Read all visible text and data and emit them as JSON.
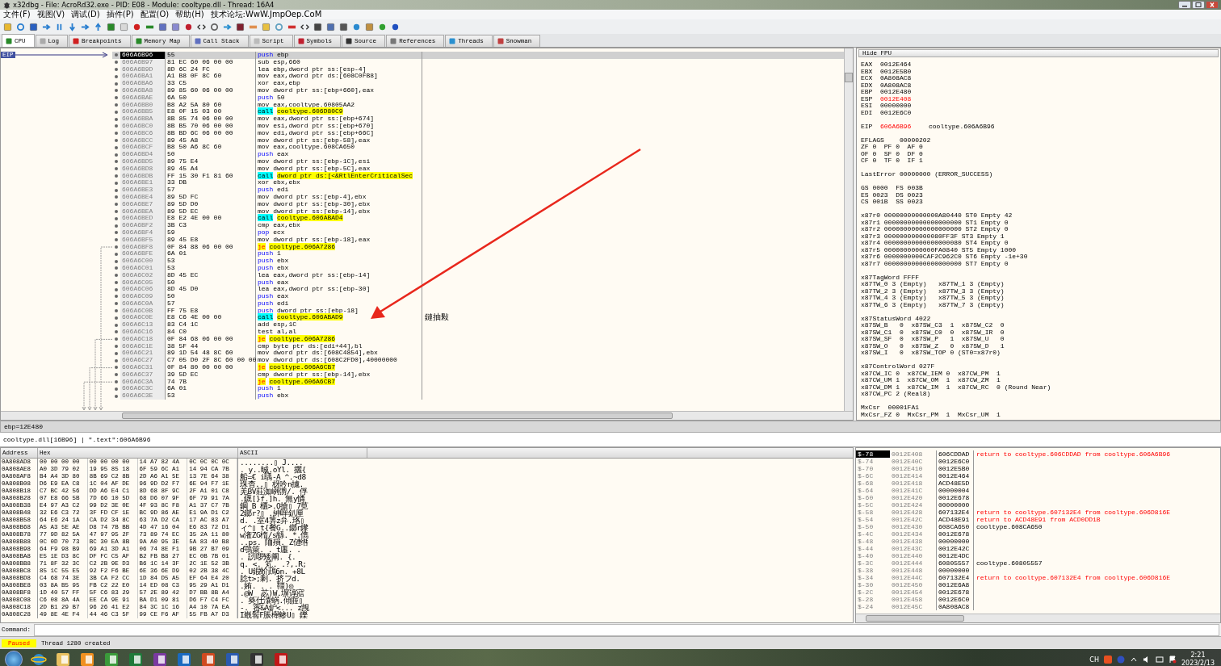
{
  "window": {
    "title": "x32dbg - File: AcroRd32.exe - PID: E08 - Module: cooltype.dll - Thread: 16A4"
  },
  "menu": [
    "文件(F)",
    "视图(V)",
    "调试(D)",
    "插件(P)",
    "配置(O)",
    "帮助(H)",
    "技术论坛:WwW.JmpOep.CoM"
  ],
  "tabs": [
    {
      "label": "CPU",
      "selected": true
    },
    {
      "label": "Log",
      "selected": false
    },
    {
      "label": "Breakpoints",
      "selected": false
    },
    {
      "label": "Memory Map",
      "selected": false
    },
    {
      "label": "Call Stack",
      "selected": false
    },
    {
      "label": "Script",
      "selected": false
    },
    {
      "label": "Symbols",
      "selected": false
    },
    {
      "label": "Source",
      "selected": false
    },
    {
      "label": "References",
      "selected": false
    },
    {
      "label": "Threads",
      "selected": false
    },
    {
      "label": "Snowman",
      "selected": false
    }
  ],
  "disassembly": {
    "eip_label": "EIP",
    "rows": [
      {
        "address": "606A6B96",
        "bytes": "55",
        "mnemonic": "push",
        "operands": "ebp",
        "kind": "push",
        "selected": true
      },
      {
        "address": "606A6B97",
        "bytes": "81 EC 60 06 00 00",
        "mnemonic": "sub",
        "operands": "esp,660",
        "kind": "plain",
        "selected": false
      },
      {
        "address": "606A6B9D",
        "bytes": "8D 6C 24 FC",
        "mnemonic": "lea",
        "operands": "ebp,dword ptr ss:[esp-4]",
        "kind": "plain",
        "selected": false
      },
      {
        "address": "606A6BA1",
        "bytes": "A1 B8 0F 8C 60",
        "mnemonic": "mov",
        "operands": "eax,dword ptr ds:[608C0FB8]",
        "kind": "plain",
        "selected": false
      },
      {
        "address": "606A6BA6",
        "bytes": "33 C5",
        "mnemonic": "xor",
        "operands": "eax,ebp",
        "kind": "plain",
        "selected": false
      },
      {
        "address": "606A6BA8",
        "bytes": "89 85 60 06 00 00",
        "mnemonic": "mov",
        "operands": "dword ptr ss:[ebp+660],eax",
        "kind": "plain",
        "selected": false
      },
      {
        "address": "606A6BAE",
        "bytes": "6A 50",
        "mnemonic": "push",
        "operands": "50",
        "kind": "push",
        "selected": false
      },
      {
        "address": "606A6BB0",
        "bytes": "B8 A2 5A 80 60",
        "mnemonic": "mov",
        "operands": "eax,cooltype.60805AA2",
        "kind": "plain",
        "selected": false
      },
      {
        "address": "606A6BB5",
        "bytes": "E8 0F 15 03 00",
        "mnemonic": "call",
        "operands": "cooltype.606D80C9",
        "kind": "call",
        "selected": false
      },
      {
        "address": "606A6BBA",
        "bytes": "8B 85 74 06 00 00",
        "mnemonic": "mov",
        "operands": "eax,dword ptr ss:[ebp+674]",
        "kind": "plain",
        "selected": false
      },
      {
        "address": "606A6BC0",
        "bytes": "8B B5 70 06 00 00",
        "mnemonic": "mov",
        "operands": "esi,dword ptr ss:[ebp+670]",
        "kind": "plain",
        "selected": false
      },
      {
        "address": "606A6BC6",
        "bytes": "8B BD 6C 06 00 00",
        "mnemonic": "mov",
        "operands": "edi,dword ptr ss:[ebp+66C]",
        "kind": "plain",
        "selected": false
      },
      {
        "address": "606A6BCC",
        "bytes": "89 45 A8",
        "mnemonic": "mov",
        "operands": "dword ptr ss:[ebp-58],eax",
        "kind": "plain",
        "selected": false
      },
      {
        "address": "606A6BCF",
        "bytes": "B8 50 A6 8C 60",
        "mnemonic": "mov",
        "operands": "eax,cooltype.608CA650",
        "kind": "plain",
        "selected": false
      },
      {
        "address": "606A6BD4",
        "bytes": "50",
        "mnemonic": "push",
        "operands": "eax",
        "kind": "push",
        "selected": false
      },
      {
        "address": "606A6BD5",
        "bytes": "89 75 E4",
        "mnemonic": "mov",
        "operands": "dword ptr ss:[ebp-1C],esi",
        "kind": "plain",
        "selected": false
      },
      {
        "address": "606A6BD8",
        "bytes": "89 45 A4",
        "mnemonic": "mov",
        "operands": "dword ptr ss:[ebp-5C],eax",
        "kind": "plain",
        "selected": false
      },
      {
        "address": "606A6BDB",
        "bytes": "FF 15 30 F1 81 60",
        "mnemonic": "call",
        "operands": "dword ptr ds:[<&RtlEnterCriticalSec",
        "kind": "call",
        "selected": false
      },
      {
        "address": "606A6BE1",
        "bytes": "33 DB",
        "mnemonic": "xor",
        "operands": "ebx,ebx",
        "kind": "plain",
        "selected": false
      },
      {
        "address": "606A6BE3",
        "bytes": "57",
        "mnemonic": "push",
        "operands": "edi",
        "kind": "push",
        "selected": false
      },
      {
        "address": "606A6BE4",
        "bytes": "89 5D FC",
        "mnemonic": "mov",
        "operands": "dword ptr ss:[ebp-4],ebx",
        "kind": "plain",
        "selected": false
      },
      {
        "address": "606A6BE7",
        "bytes": "89 5D D0",
        "mnemonic": "mov",
        "operands": "dword ptr ss:[ebp-30],ebx",
        "kind": "plain",
        "selected": false
      },
      {
        "address": "606A6BEA",
        "bytes": "89 5D EC",
        "mnemonic": "mov",
        "operands": "dword ptr ss:[ebp-14],ebx",
        "kind": "plain",
        "selected": false
      },
      {
        "address": "606A6BED",
        "bytes": "E8 E2 4E 00 00",
        "mnemonic": "call",
        "operands": "cooltype.606ABAD4",
        "kind": "call",
        "selected": false
      },
      {
        "address": "606A6BF2",
        "bytes": "3B C3",
        "mnemonic": "cmp",
        "operands": "eax,ebx",
        "kind": "plain",
        "selected": false
      },
      {
        "address": "606A6BF4",
        "bytes": "59",
        "mnemonic": "pop",
        "operands": "ecx",
        "kind": "push",
        "selected": false
      },
      {
        "address": "606A6BF5",
        "bytes": "89 45 E8",
        "mnemonic": "mov",
        "operands": "dword ptr ss:[ebp-18],eax",
        "kind": "plain",
        "selected": false
      },
      {
        "address": "606A6BF8",
        "bytes": "0F 84 88 06 00 00",
        "mnemonic": "je",
        "operands": "cooltype.606A7286",
        "kind": "jump",
        "selected": false
      },
      {
        "address": "606A6BFE",
        "bytes": "6A 01",
        "mnemonic": "push",
        "operands": "1",
        "kind": "push",
        "selected": false
      },
      {
        "address": "606A6C00",
        "bytes": "53",
        "mnemonic": "push",
        "operands": "ebx",
        "kind": "push",
        "selected": false
      },
      {
        "address": "606A6C01",
        "bytes": "53",
        "mnemonic": "push",
        "operands": "ebx",
        "kind": "push",
        "selected": false
      },
      {
        "address": "606A6C02",
        "bytes": "8D 45 EC",
        "mnemonic": "lea",
        "operands": "eax,dword ptr ss:[ebp-14]",
        "kind": "plain",
        "selected": false
      },
      {
        "address": "606A6C05",
        "bytes": "50",
        "mnemonic": "push",
        "operands": "eax",
        "kind": "push",
        "selected": false
      },
      {
        "address": "606A6C06",
        "bytes": "8D 45 D0",
        "mnemonic": "lea",
        "operands": "eax,dword ptr ss:[ebp-30]",
        "kind": "plain",
        "selected": false
      },
      {
        "address": "606A6C09",
        "bytes": "50",
        "mnemonic": "push",
        "operands": "eax",
        "kind": "push",
        "selected": false
      },
      {
        "address": "606A6C0A",
        "bytes": "57",
        "mnemonic": "push",
        "operands": "edi",
        "kind": "push",
        "selected": false
      },
      {
        "address": "606A6C0B",
        "bytes": "FF 75 E8",
        "mnemonic": "push",
        "operands": "dword ptr ss:[ebp-18]",
        "kind": "push",
        "selected": false
      },
      {
        "address": "606A6C0E",
        "bytes": "E8 C6 4E 00 00",
        "mnemonic": "call",
        "operands": "cooltype.606ABAD9",
        "kind": "call",
        "selected": false,
        "comment": "鏈抽敤"
      },
      {
        "address": "606A6C13",
        "bytes": "83 C4 1C",
        "mnemonic": "add",
        "operands": "esp,1C",
        "kind": "plain",
        "selected": false
      },
      {
        "address": "606A6C16",
        "bytes": "84 C0",
        "mnemonic": "test",
        "operands": "al,al",
        "kind": "plain",
        "selected": false
      },
      {
        "address": "606A6C18",
        "bytes": "0F 84 68 06 00 00",
        "mnemonic": "je",
        "operands": "cooltype.606A7286",
        "kind": "jump",
        "selected": false
      },
      {
        "address": "606A6C1E",
        "bytes": "38 5F 44",
        "mnemonic": "cmp",
        "operands": "byte ptr ds:[edi+44],bl",
        "kind": "plain",
        "selected": false
      },
      {
        "address": "606A6C21",
        "bytes": "89 1D 54 48 8C 60",
        "mnemonic": "mov",
        "operands": "dword ptr ds:[608C4854],ebx",
        "kind": "plain",
        "selected": false
      },
      {
        "address": "606A6C27",
        "bytes": "C7 05 D0 2F 8C 60 00 00",
        "mnemonic": "mov",
        "operands": "dword ptr ds:[608C2FD0],40000000",
        "kind": "plain",
        "selected": false
      },
      {
        "address": "606A6C31",
        "bytes": "0F 84 80 00 00 00",
        "mnemonic": "je",
        "operands": "cooltype.606A6CB7",
        "kind": "jump",
        "selected": false
      },
      {
        "address": "606A6C37",
        "bytes": "39 5D EC",
        "mnemonic": "cmp",
        "operands": "dword ptr ss:[ebp-14],ebx",
        "kind": "plain",
        "selected": false
      },
      {
        "address": "606A6C3A",
        "bytes": "74 7B",
        "mnemonic": "je",
        "operands": "cooltype.606A6CB7",
        "kind": "jump",
        "selected": false
      },
      {
        "address": "606A6C3C",
        "bytes": "6A 01",
        "mnemonic": "push",
        "operands": "1",
        "kind": "push",
        "selected": false
      },
      {
        "address": "606A6C3E",
        "bytes": "53",
        "mnemonic": "push",
        "operands": "ebx",
        "kind": "push",
        "selected": false
      }
    ]
  },
  "info_bar": "ebp=12E480",
  "info_line": "cooltype.dll[16B96] | \".text\":606A6B96",
  "registers": {
    "button": "Hide FPU",
    "general": [
      {
        "name": "EAX",
        "value": "0012E464",
        "modified": false
      },
      {
        "name": "EBX",
        "value": "0012E5B0",
        "modified": false
      },
      {
        "name": "ECX",
        "value": "0A808AC8",
        "modified": false
      },
      {
        "name": "EDX",
        "value": "0A808AC8",
        "modified": false
      },
      {
        "name": "EBP",
        "value": "0012E480",
        "modified": false
      },
      {
        "name": "ESP",
        "value": "0012E408",
        "modified": true
      },
      {
        "name": "ESI",
        "value": "00000000",
        "modified": false
      },
      {
        "name": "EDI",
        "value": "0012E6C0",
        "modified": false
      }
    ],
    "eip": {
      "name": "EIP",
      "value": "606A6B96",
      "modified": true,
      "comment": "cooltype.606A6B96"
    },
    "groups": [
      [
        "EFLAGS    00000202",
        "ZF 0  PF 0  AF 0",
        "OF 0  SF 0  DF 0",
        "CF 0  TF 0  IF 1"
      ],
      [
        "LastError 00000000 (ERROR_SUCCESS)"
      ],
      [
        "GS 0000  FS 003B",
        "ES 0023  DS 0023",
        "CS 001B  SS 0023"
      ],
      [
        "x87r0 00000000000000A80440 ST0 Empty 42",
        "x87r1 00000000000000000000 ST1 Empty 0",
        "x87r2 00000000000000000000 ST2 Empty 0",
        "x87r3 000000000000080FF3F ST3 Empty 1",
        "x87r4 00000000000000000080 ST4 Empty 0",
        "x87r5 0000000000000FA0840 ST5 Empty 1000",
        "x87r6 0000000000CAF2C962C0 ST6 Empty -1e+30",
        "x87r7 00000000000000000000 ST7 Empty 0"
      ],
      [
        "x87TagWord FFFF",
        "x87TW_0 3 (Empty)   x87TW_1 3 (Empty)",
        "x87TW_2 3 (Empty)   x87TW_3 3 (Empty)",
        "x87TW_4 3 (Empty)   x87TW_5 3 (Empty)",
        "x87TW_6 3 (Empty)   x87TW_7 3 (Empty)"
      ],
      [
        "x87StatusWord 4022",
        "x87SW_B   0  x87SW_C3  1  x87SW_C2  0",
        "x87SW_C1  0  x87SW_C0  0  x87SW_IR  0",
        "x87SW_SF  0  x87SW_P   1  x87SW_U   0",
        "x87SW_O   0  x87SW_Z   0  x87SW_D   1",
        "x87SW_I   0  x87SW_TOP 0 (ST0=x87r0)"
      ],
      [
        "x87ControlWord 027F",
        "x87CW_IC 0  x87CW_IEM 0  x87CW_PM  1",
        "x87CW_UM 1  x87CW_OM  1  x87CW_ZM  1",
        "x87CW_DM 1  x87CW_IM  1  x87CW_RC  0 (Round Near)",
        "x87CW_PC 2 (Real8)"
      ],
      [
        "MxCsr  00001FA1",
        "MxCsr_FZ 0  MxCsr_PM  1  MxCsr_UM  1"
      ]
    ]
  },
  "dump": {
    "columns": [
      "Address",
      "Hex",
      "ASCII"
    ],
    "rows": [
      {
        "address": "0A808AD8",
        "hex": [
          "00 00 00 00",
          "00 00 00 00",
          "14 A7 82 4A",
          "0C 0C 0C 0C"
        ],
        "ascii": "........▯ J...."
      },
      {
        "address": "0A808AE8",
        "hex": [
          "A0 3D 79 02",
          "19 95 85 18",
          "6F 59 6C A1",
          "14 94 CA 7B"
        ],
        "ascii": ". y..晠.oYl. 攦{"
      },
      {
        "address": "0A808AF8",
        "hex": [
          "B4 A4 3D 80",
          "8B 69 C2 8B",
          "2D A6 A1 5E",
          "13 7E 64 38"
        ],
        "ascii": "船=€ i聥-A ^.~d8"
      },
      {
        "address": "0A808B08",
        "hex": [
          "D6 E9 EA C8",
          "1C 04 AF DE",
          "96 9D D2 F7",
          "6E 94 F7 1E"
        ],
        "ascii": "珠杳..▯ 枒吟n攄."
      },
      {
        "address": "0A808B18",
        "hex": [
          "C7 BC 42 56",
          "DD A6 E4 C1",
          "8D 68 8F 9C",
          "2F A1 01 C8"
        ],
        "ascii": "羌BV莊洳峢彅/. 俘"
      },
      {
        "address": "0A808B28",
        "hex": [
          "07 E8 66 5B",
          "7D 66 10 5D",
          "68 D6 07 9F",
          "6F 79 91 7A"
        ],
        "ascii": ".鑖[}f.]h. 無y憐"
      },
      {
        "address": "0A808B38",
        "hex": [
          "E4 97 A3 C2",
          "99 D2 3E 0E",
          "4F 93 8C F8",
          "A1 37 C7 7B"
        ],
        "ascii": "鋼 B 櫃>.O搶▯ 7莧"
      },
      {
        "address": "0A808B48",
        "hex": [
          "32 E6 C3 72",
          "3F FD CF 1E",
          "BC 9D 86 AE",
          "E1 9A D1 C2"
        ],
        "ascii": "2鎯r?▯ .紳啴釟厘"
      },
      {
        "address": "0A808B58",
        "hex": [
          "64 E6 24 1A",
          "CA D2 34 8C",
          "63 7A D2 CA",
          "17 AC 83 A7"
        ],
        "ascii": "d. .室4筭z弁.珞▯"
      },
      {
        "address": "0A808B68",
        "hex": [
          "A5 A3 5E AE",
          "D8 74 7B BB",
          "4D 47 16 04",
          "E6 83 72 D1"
        ],
        "ascii": "ィ^▯ t{餐G..鎯r鑗"
      },
      {
        "address": "0A808B78",
        "hex": [
          "77 9D 82 5A",
          "47 97 95 2F",
          "73 89 74 EC",
          "35 2A 11 80"
        ],
        "ascii": "w潅ZG楕/s緜. *.儁"
      },
      {
        "address": "0A808B88",
        "hex": [
          "0C 0D 70 73",
          "BC 30 EA 8B",
          "9A A0 95 3E",
          "5A 83 40 B8"
        ],
        "ascii": "..ps. 陑殞. Z僆绺"
      },
      {
        "address": "0A808B98",
        "hex": [
          "64 F9 98 B9",
          "69 A1 3D A1",
          "06 74 8E F1",
          "9B 27 B7 09"
        ],
        "ascii": "d鶚箂. . t廛. ."
      },
      {
        "address": "0A808BA8",
        "hex": [
          "E5 1E D3 8C",
          "DF FC C5 AF",
          "B2 FB B8 27",
          "EC 0B 7B 01"
        ],
        "ascii": ". 訒啰矮阐. {."
      },
      {
        "address": "0A808BB8",
        "hex": [
          "71 8F 32 3C",
          "C2 2B 9E D3",
          "B6 1C 14 3F",
          "2C 1E 52 3B"
        ],
        "ascii": "q. <. 笂. .?,.R;"
      },
      {
        "address": "0A808BC8",
        "hex": [
          "85 1C 55 E5",
          "92 F2 F6 BE",
          "6E 36 6E D9",
          "02 2B 38 4C"
        ],
        "ascii": ". U鍜蚧鴊6n. +8L"
      },
      {
        "address": "0A808BD8",
        "hex": [
          "C4 68 74 3E",
          "3B CA F2 CC",
          "1D 84 D5 A5",
          "EF 64 E4 20"
        ],
        "ascii": "腍t>;剩. 挤フd. "
      },
      {
        "address": "0A808BE8",
        "hex": [
          "03 8A B5 95",
          "FB C2 22 E0",
          "14 ED 08 C3",
          "95 29 A1 D1"
        ],
        "ascii": ".姷. . . 韁)◎"
      },
      {
        "address": "0A808BF8",
        "hex": [
          "1D 40 57 FF",
          "5F C6 83 29",
          "57 2E 89 42",
          "D7 BB 8B A4"
        ],
        "ascii": ".@W_ 苾)W.塀谆寣"
      },
      {
        "address": "0A808C08",
        "hex": [
          "C6 08 8A 4A",
          "EE CA 9E 91",
          "BA D1 09 81",
          "D6 F7 C4 FC"
        ],
        "ascii": ". 奐仕灢蜹.傾腟▯"
      },
      {
        "address": "0A808C18",
        "hex": [
          "2D B1 29 B7",
          "96 26 41 E2",
          "84 3C 1C 16",
          "A4 10 7A EA"
        ],
        "ascii": "-. 宻&A鈩<... z觊"
      },
      {
        "address": "0A808C28",
        "hex": [
          "49 8E 4E F4",
          "44 46 C3 5F",
          "99 CE F6 AF",
          "55 FB A7 D3"
        ],
        "ascii": "I嶯鬌F脹櫸鲹U▯ 鑠"
      }
    ]
  },
  "stack": {
    "rows": [
      {
        "offset": "$-78",
        "address": "0012E408",
        "value": "606CDDAD",
        "comment": "return to cooltype.606CDDAD from cooltype.606A6B96",
        "kind": "return",
        "selected": true
      },
      {
        "offset": "$-74",
        "address": "0012E40C",
        "value": "0012E6C0",
        "selected": false
      },
      {
        "offset": "$-70",
        "address": "0012E410",
        "value": "0012E5B0",
        "selected": false
      },
      {
        "offset": "$-6C",
        "address": "0012E414",
        "value": "0012E464",
        "selected": false
      },
      {
        "offset": "$-68",
        "address": "0012E418",
        "value": "ACD48E5D",
        "selected": false
      },
      {
        "offset": "$-64",
        "address": "0012E41C",
        "value": "00000004",
        "selected": false
      },
      {
        "offset": "$-60",
        "address": "0012E420",
        "value": "0012E678",
        "selected": false
      },
      {
        "offset": "$-5C",
        "address": "0012E424",
        "value": "00000000",
        "selected": false
      },
      {
        "offset": "$-58",
        "address": "0012E428",
        "value": "607132E4",
        "comment": "return to cooltype.607132E4 from cooltype.606D816E",
        "kind": "return",
        "selected": false
      },
      {
        "offset": "$-54",
        "address": "0012E42C",
        "value": "ACD48E91",
        "comment": "return to ACD48E91 from ACD0DD1B",
        "kind": "return",
        "selected": false
      },
      {
        "offset": "$-50",
        "address": "0012E430",
        "value": "608CA650",
        "comment": "cooltype.608CA650",
        "kind": "plain",
        "selected": false
      },
      {
        "offset": "$-4C",
        "address": "0012E434",
        "value": "0012E678",
        "selected": false
      },
      {
        "offset": "$-48",
        "address": "0012E438",
        "value": "00000000",
        "selected": false
      },
      {
        "offset": "$-44",
        "address": "0012E43C",
        "value": "0012E42C",
        "selected": false
      },
      {
        "offset": "$-40",
        "address": "0012E440",
        "value": "0012E4DC",
        "selected": false
      },
      {
        "offset": "$-3C",
        "address": "0012E444",
        "value": "60805557",
        "comment": "cooltype.60805557",
        "kind": "plain",
        "selected": false
      },
      {
        "offset": "$-38",
        "address": "0012E448",
        "value": "00000000",
        "selected": false
      },
      {
        "offset": "$-34",
        "address": "0012E44C",
        "value": "607132E4",
        "comment": "return to cooltype.607132E4 from cooltype.606D816E",
        "kind": "return",
        "selected": false
      },
      {
        "offset": "$-30",
        "address": "0012E450",
        "value": "0012E6A8",
        "selected": false
      },
      {
        "offset": "$-2C",
        "address": "0012E454",
        "value": "0012E678",
        "selected": false
      },
      {
        "offset": "$-28",
        "address": "0012E458",
        "value": "0012E6C0",
        "selected": false
      },
      {
        "offset": "$-24",
        "address": "0012E45C",
        "value": "0A808AC8",
        "selected": false
      }
    ]
  },
  "command": {
    "label": "Command:"
  },
  "status": {
    "state": "Paused",
    "kind": "paused",
    "message": "Thread 1280 created"
  },
  "tray": {
    "language": "CH",
    "time": "2:21",
    "date": "2023/2/13"
  }
}
